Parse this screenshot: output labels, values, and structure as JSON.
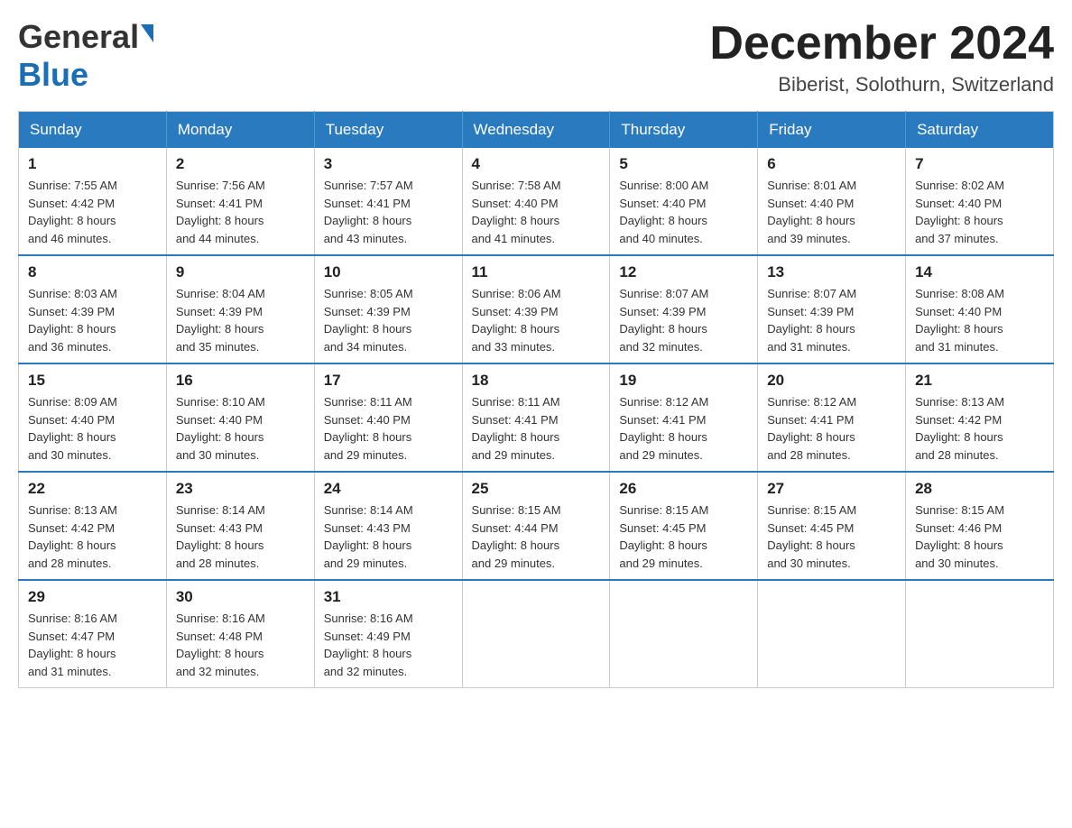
{
  "header": {
    "logo_general": "General",
    "logo_blue": "Blue",
    "month_title": "December 2024",
    "location": "Biberist, Solothurn, Switzerland"
  },
  "weekdays": [
    "Sunday",
    "Monday",
    "Tuesday",
    "Wednesday",
    "Thursday",
    "Friday",
    "Saturday"
  ],
  "weeks": [
    [
      {
        "day": "1",
        "sunrise": "7:55 AM",
        "sunset": "4:42 PM",
        "daylight": "8 hours and 46 minutes."
      },
      {
        "day": "2",
        "sunrise": "7:56 AM",
        "sunset": "4:41 PM",
        "daylight": "8 hours and 44 minutes."
      },
      {
        "day": "3",
        "sunrise": "7:57 AM",
        "sunset": "4:41 PM",
        "daylight": "8 hours and 43 minutes."
      },
      {
        "day": "4",
        "sunrise": "7:58 AM",
        "sunset": "4:40 PM",
        "daylight": "8 hours and 41 minutes."
      },
      {
        "day": "5",
        "sunrise": "8:00 AM",
        "sunset": "4:40 PM",
        "daylight": "8 hours and 40 minutes."
      },
      {
        "day": "6",
        "sunrise": "8:01 AM",
        "sunset": "4:40 PM",
        "daylight": "8 hours and 39 minutes."
      },
      {
        "day": "7",
        "sunrise": "8:02 AM",
        "sunset": "4:40 PM",
        "daylight": "8 hours and 37 minutes."
      }
    ],
    [
      {
        "day": "8",
        "sunrise": "8:03 AM",
        "sunset": "4:39 PM",
        "daylight": "8 hours and 36 minutes."
      },
      {
        "day": "9",
        "sunrise": "8:04 AM",
        "sunset": "4:39 PM",
        "daylight": "8 hours and 35 minutes."
      },
      {
        "day": "10",
        "sunrise": "8:05 AM",
        "sunset": "4:39 PM",
        "daylight": "8 hours and 34 minutes."
      },
      {
        "day": "11",
        "sunrise": "8:06 AM",
        "sunset": "4:39 PM",
        "daylight": "8 hours and 33 minutes."
      },
      {
        "day": "12",
        "sunrise": "8:07 AM",
        "sunset": "4:39 PM",
        "daylight": "8 hours and 32 minutes."
      },
      {
        "day": "13",
        "sunrise": "8:07 AM",
        "sunset": "4:39 PM",
        "daylight": "8 hours and 31 minutes."
      },
      {
        "day": "14",
        "sunrise": "8:08 AM",
        "sunset": "4:40 PM",
        "daylight": "8 hours and 31 minutes."
      }
    ],
    [
      {
        "day": "15",
        "sunrise": "8:09 AM",
        "sunset": "4:40 PM",
        "daylight": "8 hours and 30 minutes."
      },
      {
        "day": "16",
        "sunrise": "8:10 AM",
        "sunset": "4:40 PM",
        "daylight": "8 hours and 30 minutes."
      },
      {
        "day": "17",
        "sunrise": "8:11 AM",
        "sunset": "4:40 PM",
        "daylight": "8 hours and 29 minutes."
      },
      {
        "day": "18",
        "sunrise": "8:11 AM",
        "sunset": "4:41 PM",
        "daylight": "8 hours and 29 minutes."
      },
      {
        "day": "19",
        "sunrise": "8:12 AM",
        "sunset": "4:41 PM",
        "daylight": "8 hours and 29 minutes."
      },
      {
        "day": "20",
        "sunrise": "8:12 AM",
        "sunset": "4:41 PM",
        "daylight": "8 hours and 28 minutes."
      },
      {
        "day": "21",
        "sunrise": "8:13 AM",
        "sunset": "4:42 PM",
        "daylight": "8 hours and 28 minutes."
      }
    ],
    [
      {
        "day": "22",
        "sunrise": "8:13 AM",
        "sunset": "4:42 PM",
        "daylight": "8 hours and 28 minutes."
      },
      {
        "day": "23",
        "sunrise": "8:14 AM",
        "sunset": "4:43 PM",
        "daylight": "8 hours and 28 minutes."
      },
      {
        "day": "24",
        "sunrise": "8:14 AM",
        "sunset": "4:43 PM",
        "daylight": "8 hours and 29 minutes."
      },
      {
        "day": "25",
        "sunrise": "8:15 AM",
        "sunset": "4:44 PM",
        "daylight": "8 hours and 29 minutes."
      },
      {
        "day": "26",
        "sunrise": "8:15 AM",
        "sunset": "4:45 PM",
        "daylight": "8 hours and 29 minutes."
      },
      {
        "day": "27",
        "sunrise": "8:15 AM",
        "sunset": "4:45 PM",
        "daylight": "8 hours and 30 minutes."
      },
      {
        "day": "28",
        "sunrise": "8:15 AM",
        "sunset": "4:46 PM",
        "daylight": "8 hours and 30 minutes."
      }
    ],
    [
      {
        "day": "29",
        "sunrise": "8:16 AM",
        "sunset": "4:47 PM",
        "daylight": "8 hours and 31 minutes."
      },
      {
        "day": "30",
        "sunrise": "8:16 AM",
        "sunset": "4:48 PM",
        "daylight": "8 hours and 32 minutes."
      },
      {
        "day": "31",
        "sunrise": "8:16 AM",
        "sunset": "4:49 PM",
        "daylight": "8 hours and 32 minutes."
      },
      null,
      null,
      null,
      null
    ]
  ],
  "labels": {
    "sunrise": "Sunrise:",
    "sunset": "Sunset:",
    "daylight": "Daylight:"
  }
}
